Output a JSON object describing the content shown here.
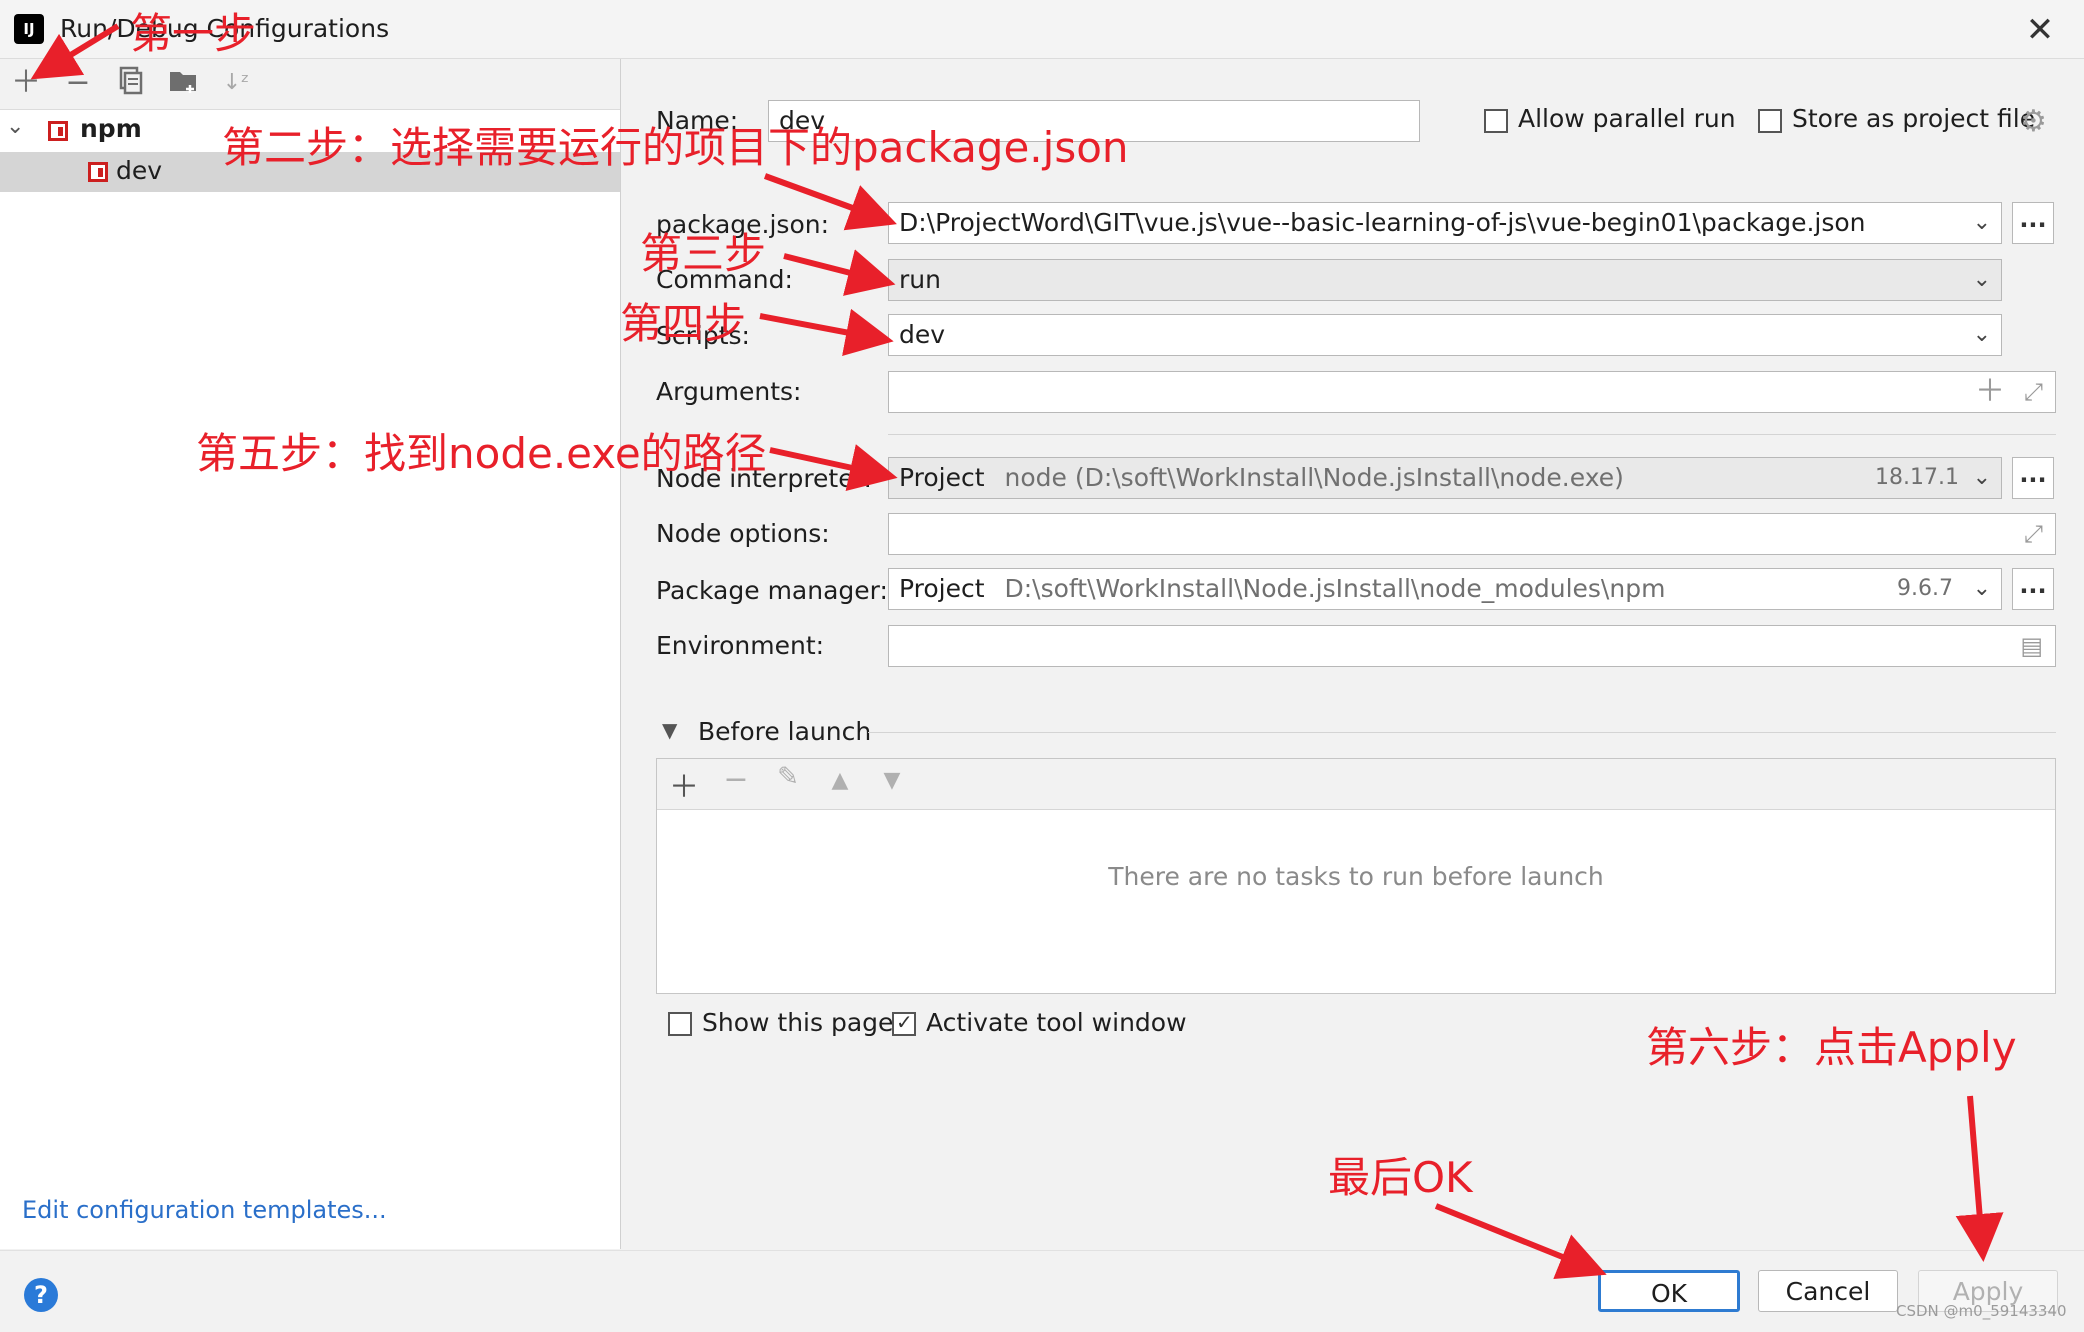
{
  "window": {
    "title": "Run/Debug Configurations",
    "app_icon_text": "IJ",
    "close_glyph": "✕"
  },
  "left": {
    "toolbar": [
      "add-icon",
      "remove-icon",
      "copy-icon",
      "folder-add-icon",
      "sort-icon"
    ],
    "tree": {
      "group_label": "npm",
      "item_label": "dev"
    },
    "edit_templates": "Edit configuration templates..."
  },
  "form": {
    "name_label": "Name:",
    "name_value": "dev",
    "allow_parallel": "Allow parallel run",
    "store_project": "Store as project file",
    "package_json_label": "package.json:",
    "package_json_value": "D:\\ProjectWord\\GIT\\vue.js\\vue--basic-learning-of-js\\vue-begin01\\package.json",
    "command_label": "Command:",
    "command_value": "run",
    "scripts_label": "Scripts:",
    "scripts_value": "dev",
    "arguments_label": "Arguments:",
    "node_interpreter_label": "Node interpreter:",
    "node_interpreter_prefix": "Project",
    "node_interpreter_path": "node (D:\\soft\\WorkInstall\\Node.jsInstall\\node.exe)",
    "node_interpreter_version": "18.17.1",
    "node_options_label": "Node options:",
    "package_manager_label": "Package manager:",
    "package_manager_prefix": "Project",
    "package_manager_path": "D:\\soft\\WorkInstall\\Node.jsInstall\\node_modules\\npm",
    "package_manager_version": "9.6.7",
    "environment_label": "Environment:",
    "dots": "..."
  },
  "before_launch": {
    "title": "Before launch",
    "empty_text": "There are no tasks to run before launch"
  },
  "options": {
    "show_page": "Show this page",
    "show_page_checked": false,
    "activate_tool": "Activate tool window",
    "activate_tool_checked": true
  },
  "buttons": {
    "ok": "OK",
    "cancel": "Cancel",
    "apply": "Apply",
    "help": "?"
  },
  "annotations": {
    "step1": "第一步",
    "step2": "第二步：选择需要运行的项目下的package.json",
    "step3": "第三步",
    "step4": "第四步",
    "step5": "第五步：找到node.exe的路径",
    "step6": "第六步：点击Apply",
    "final": "最后OK",
    "color": "#e8202a"
  },
  "watermark": "CSDN @m0_59143340"
}
